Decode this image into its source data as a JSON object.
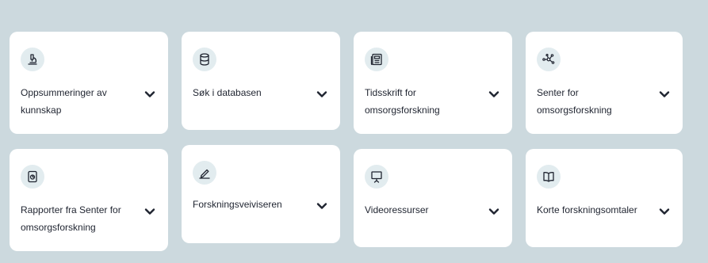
{
  "cards": [
    {
      "label_line1": "Oppsummeringer av",
      "label_line2": "kunnskap",
      "icon": "microscope-icon"
    },
    {
      "label_line1": "Søk i databasen",
      "label_line2": "",
      "icon": "database-icon"
    },
    {
      "label_line1": "Tidsskrift for",
      "label_line2": "omsorgsforskning",
      "icon": "newspaper-icon"
    },
    {
      "label_line1": "Senter for",
      "label_line2": "omsorgsforskning",
      "icon": "network-icon"
    },
    {
      "label_line1": "Rapporter fra Senter for",
      "label_line2": "omsorgsforskning",
      "icon": "report-icon"
    },
    {
      "label_line1": "Forskningsveiviseren",
      "label_line2": "",
      "icon": "pencil-icon"
    },
    {
      "label_line1": "Videoressurser",
      "label_line2": "",
      "icon": "presentation-icon"
    },
    {
      "label_line1": "Korte forskningsomtaler",
      "label_line2": "",
      "icon": "book-icon"
    }
  ],
  "colors": {
    "background": "#ccd9de",
    "card": "#ffffff",
    "icon_circle": "#e2ecef",
    "text": "#1f2430"
  }
}
